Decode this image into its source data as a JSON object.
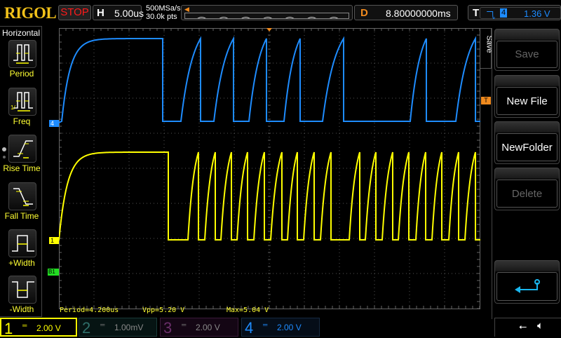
{
  "header": {
    "logo": "RIGOL",
    "run_state": "STOP",
    "horizontal_key": "H",
    "timebase": "5.00us",
    "sample_rate": "500MSa/s",
    "memory_depth": "30.0k pts",
    "delay_key": "D",
    "delay": "8.80000000ms",
    "trigger_key": "T",
    "trigger_source": "4",
    "trigger_level": "1.36 V"
  },
  "left_menu": {
    "title": "Horizontal",
    "items": [
      {
        "label": "Period"
      },
      {
        "label": "Freq"
      },
      {
        "label": "Rise Time"
      },
      {
        "label": "Fall Time"
      },
      {
        "label": "+Width"
      },
      {
        "label": "-Width"
      }
    ]
  },
  "right_menu": {
    "tab": "Save",
    "buttons": [
      {
        "label": "Save",
        "enabled": false
      },
      {
        "label": "New File",
        "enabled": true
      },
      {
        "label": "NewFolder",
        "enabled": true
      },
      {
        "label": "Delete",
        "enabled": false
      }
    ],
    "return_icon": "return-arrow-icon"
  },
  "markers": {
    "ch4": "4",
    "ch1": "1",
    "bus": "B1",
    "trigger": "T"
  },
  "measurements": {
    "period": "Period=4.200us",
    "vpp": "Vpp=5.20 V",
    "max": "Max=5.04 V"
  },
  "channels": [
    {
      "num": "1",
      "scale": "2.00 V",
      "color": "#ffff00",
      "active": true
    },
    {
      "num": "2",
      "scale": "1.00mV",
      "color": "#2f6f6a",
      "active": false
    },
    {
      "num": "3",
      "scale": "2.00 V",
      "color": "#6a2f6a",
      "active": false
    },
    {
      "num": "4",
      "scale": "2.00 V",
      "color": "#1e8cff",
      "active": true
    }
  ],
  "colors": {
    "ch1": "#ffff00",
    "ch4": "#1e8cff",
    "trigger": "#f08a1e",
    "bus": "#22dd22"
  }
}
